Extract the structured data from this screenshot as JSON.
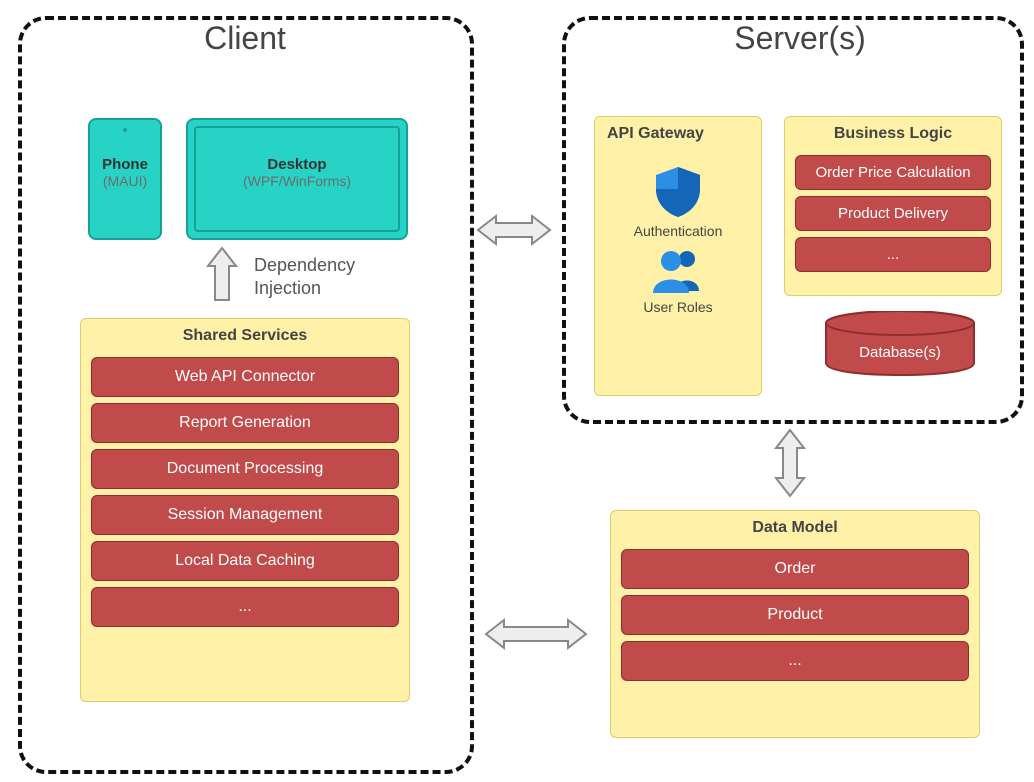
{
  "diagram": {
    "client": {
      "title": "Client",
      "phone": {
        "name": "Phone",
        "sub": "(MAUI)"
      },
      "desktop": {
        "name": "Desktop",
        "sub": "(WPF/WinForms)"
      },
      "di_label": "Dependency\nInjection",
      "shared_services": {
        "title": "Shared Services",
        "items": [
          "Web API Connector",
          "Report Generation",
          "Document Processing",
          "Session Management",
          "Local Data Caching",
          "..."
        ]
      }
    },
    "server": {
      "title": "Server(s)",
      "api_gateway": {
        "title": "API Gateway",
        "auth": "Authentication",
        "roles": "User Roles"
      },
      "business_logic": {
        "title": "Business Logic",
        "items": [
          "Order Price Calculation",
          "Product Delivery",
          "..."
        ]
      },
      "databases": "Database(s)"
    },
    "data_model": {
      "title": "Data Model",
      "items": [
        "Order",
        "Product",
        "..."
      ]
    }
  }
}
